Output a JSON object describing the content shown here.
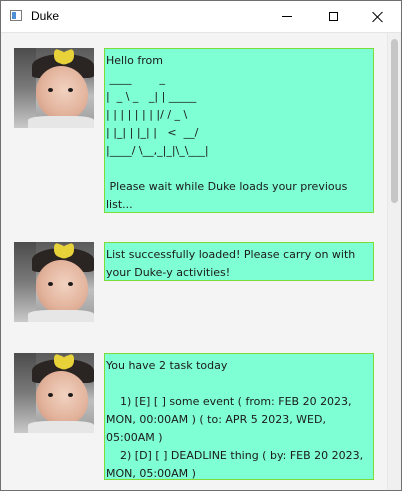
{
  "window": {
    "title": "Duke"
  },
  "messages": [
    {
      "sender": "duke",
      "text": "Hello from\n ____        _\n|  _ \\ _   _| | _____\n| | | | | | | |/ / _ \\\n| |_| | |_| |   <  __/\n|____/ \\__,_|_|\\_\\___|\n\n Please wait while Duke loads your previous list..."
    },
    {
      "sender": "duke",
      "text": "List successfully loaded! Please carry on with your Duke-y activities!"
    },
    {
      "sender": "duke",
      "text": "You have 2 task today\n\n    1) [E] [ ] some event ( from: FEB 20 2023, MON, 00:00AM ) ( to: APR 5 2023, WED, 05:00AM )\n    2) [D] [ ] DEADLINE thing ( by: FEB 20 2023, MON, 05:00AM )"
    }
  ],
  "colors": {
    "bubble_background": "#7fffd4",
    "bubble_border": "#7bdc39",
    "bow": "#e8d23a"
  }
}
